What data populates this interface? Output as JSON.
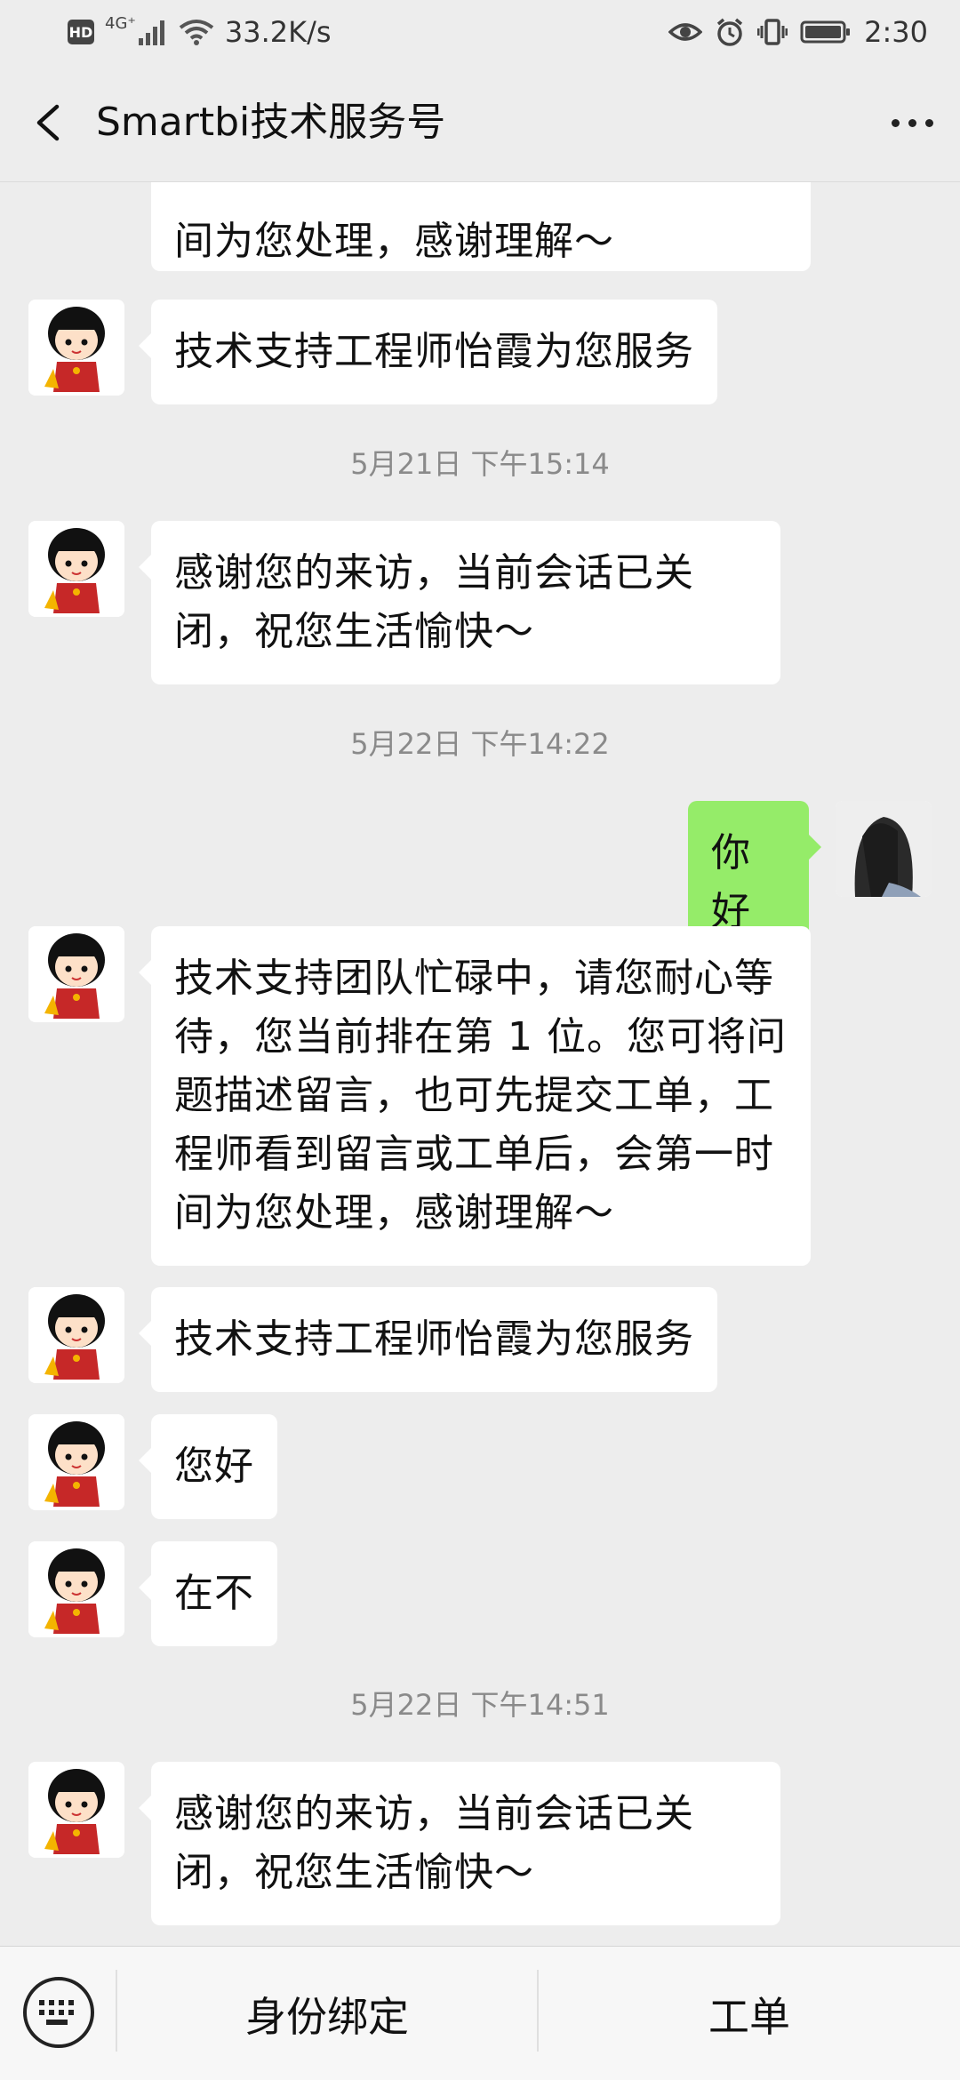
{
  "status_bar": {
    "hd": "HD",
    "network": "4G⁺",
    "speed": "33.2K/s",
    "time": "2:30"
  },
  "header": {
    "title": "Smartbi技术服务号"
  },
  "messages": [
    {
      "type": "incoming",
      "text": "工程师看到留言或工单后，会第一时间为您处理，感谢理解～",
      "visible_text": "间为您处理，感谢理解～"
    },
    {
      "type": "incoming",
      "text": "技术支持工程师怡霞为您服务"
    },
    {
      "type": "time",
      "text": "5月21日 下午15:14"
    },
    {
      "type": "incoming",
      "text": "感谢您的来访，当前会话已关闭，祝您生活愉快～"
    },
    {
      "type": "time",
      "text": "5月22日 下午14:22"
    },
    {
      "type": "outgoing",
      "text": "你好"
    },
    {
      "type": "incoming",
      "text": "技术支持团队忙碌中，请您耐心等待，您当前排在第 1 位。您可将问题描述留言，也可先提交工单，工程师看到留言或工单后，会第一时间为您处理，感谢理解～"
    },
    {
      "type": "incoming",
      "text": "技术支持工程师怡霞为您服务"
    },
    {
      "type": "incoming",
      "text": "您好"
    },
    {
      "type": "incoming",
      "text": "在不"
    },
    {
      "type": "time",
      "text": "5月22日 下午14:51"
    },
    {
      "type": "incoming",
      "text": "感谢您的来访，当前会话已关闭，祝您生活愉快～"
    }
  ],
  "bottom_menu": {
    "items": [
      {
        "label": "身份绑定"
      },
      {
        "label": "工单"
      }
    ]
  },
  "icons": {
    "back": "back-chevron-icon",
    "more": "more-dots-icon",
    "keyboard": "keyboard-icon",
    "agent_avatar": "cartoon-girl-avatar",
    "user_avatar": "user-photo-avatar"
  },
  "colors": {
    "background": "#ededed",
    "incoming_bubble": "#ffffff",
    "outgoing_bubble": "#95ec69",
    "timestamp": "#8a8a8a"
  }
}
